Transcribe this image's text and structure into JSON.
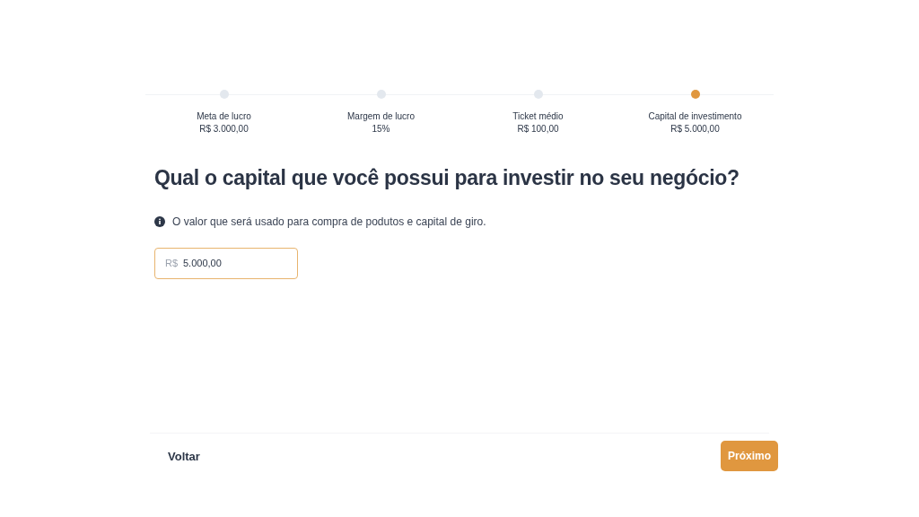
{
  "steps": [
    {
      "label": "Meta de lucro",
      "value": "R$ 3.000,00",
      "selected": false
    },
    {
      "label": "Margem de lucro",
      "value": "15%",
      "selected": false
    },
    {
      "label": "Ticket médio",
      "value": "R$ 100,00",
      "selected": false
    },
    {
      "label": "Capital de investimento",
      "value": "R$ 5.000,00",
      "selected": true
    }
  ],
  "question": "Qual o capital que você possui para investir no seu negócio?",
  "hint": "O valor que será usado para compra de podutos e capital de giro.",
  "field": {
    "prefix": "R$",
    "value": "5.000,00"
  },
  "footer": {
    "back": "Voltar",
    "next": "Próximo"
  }
}
